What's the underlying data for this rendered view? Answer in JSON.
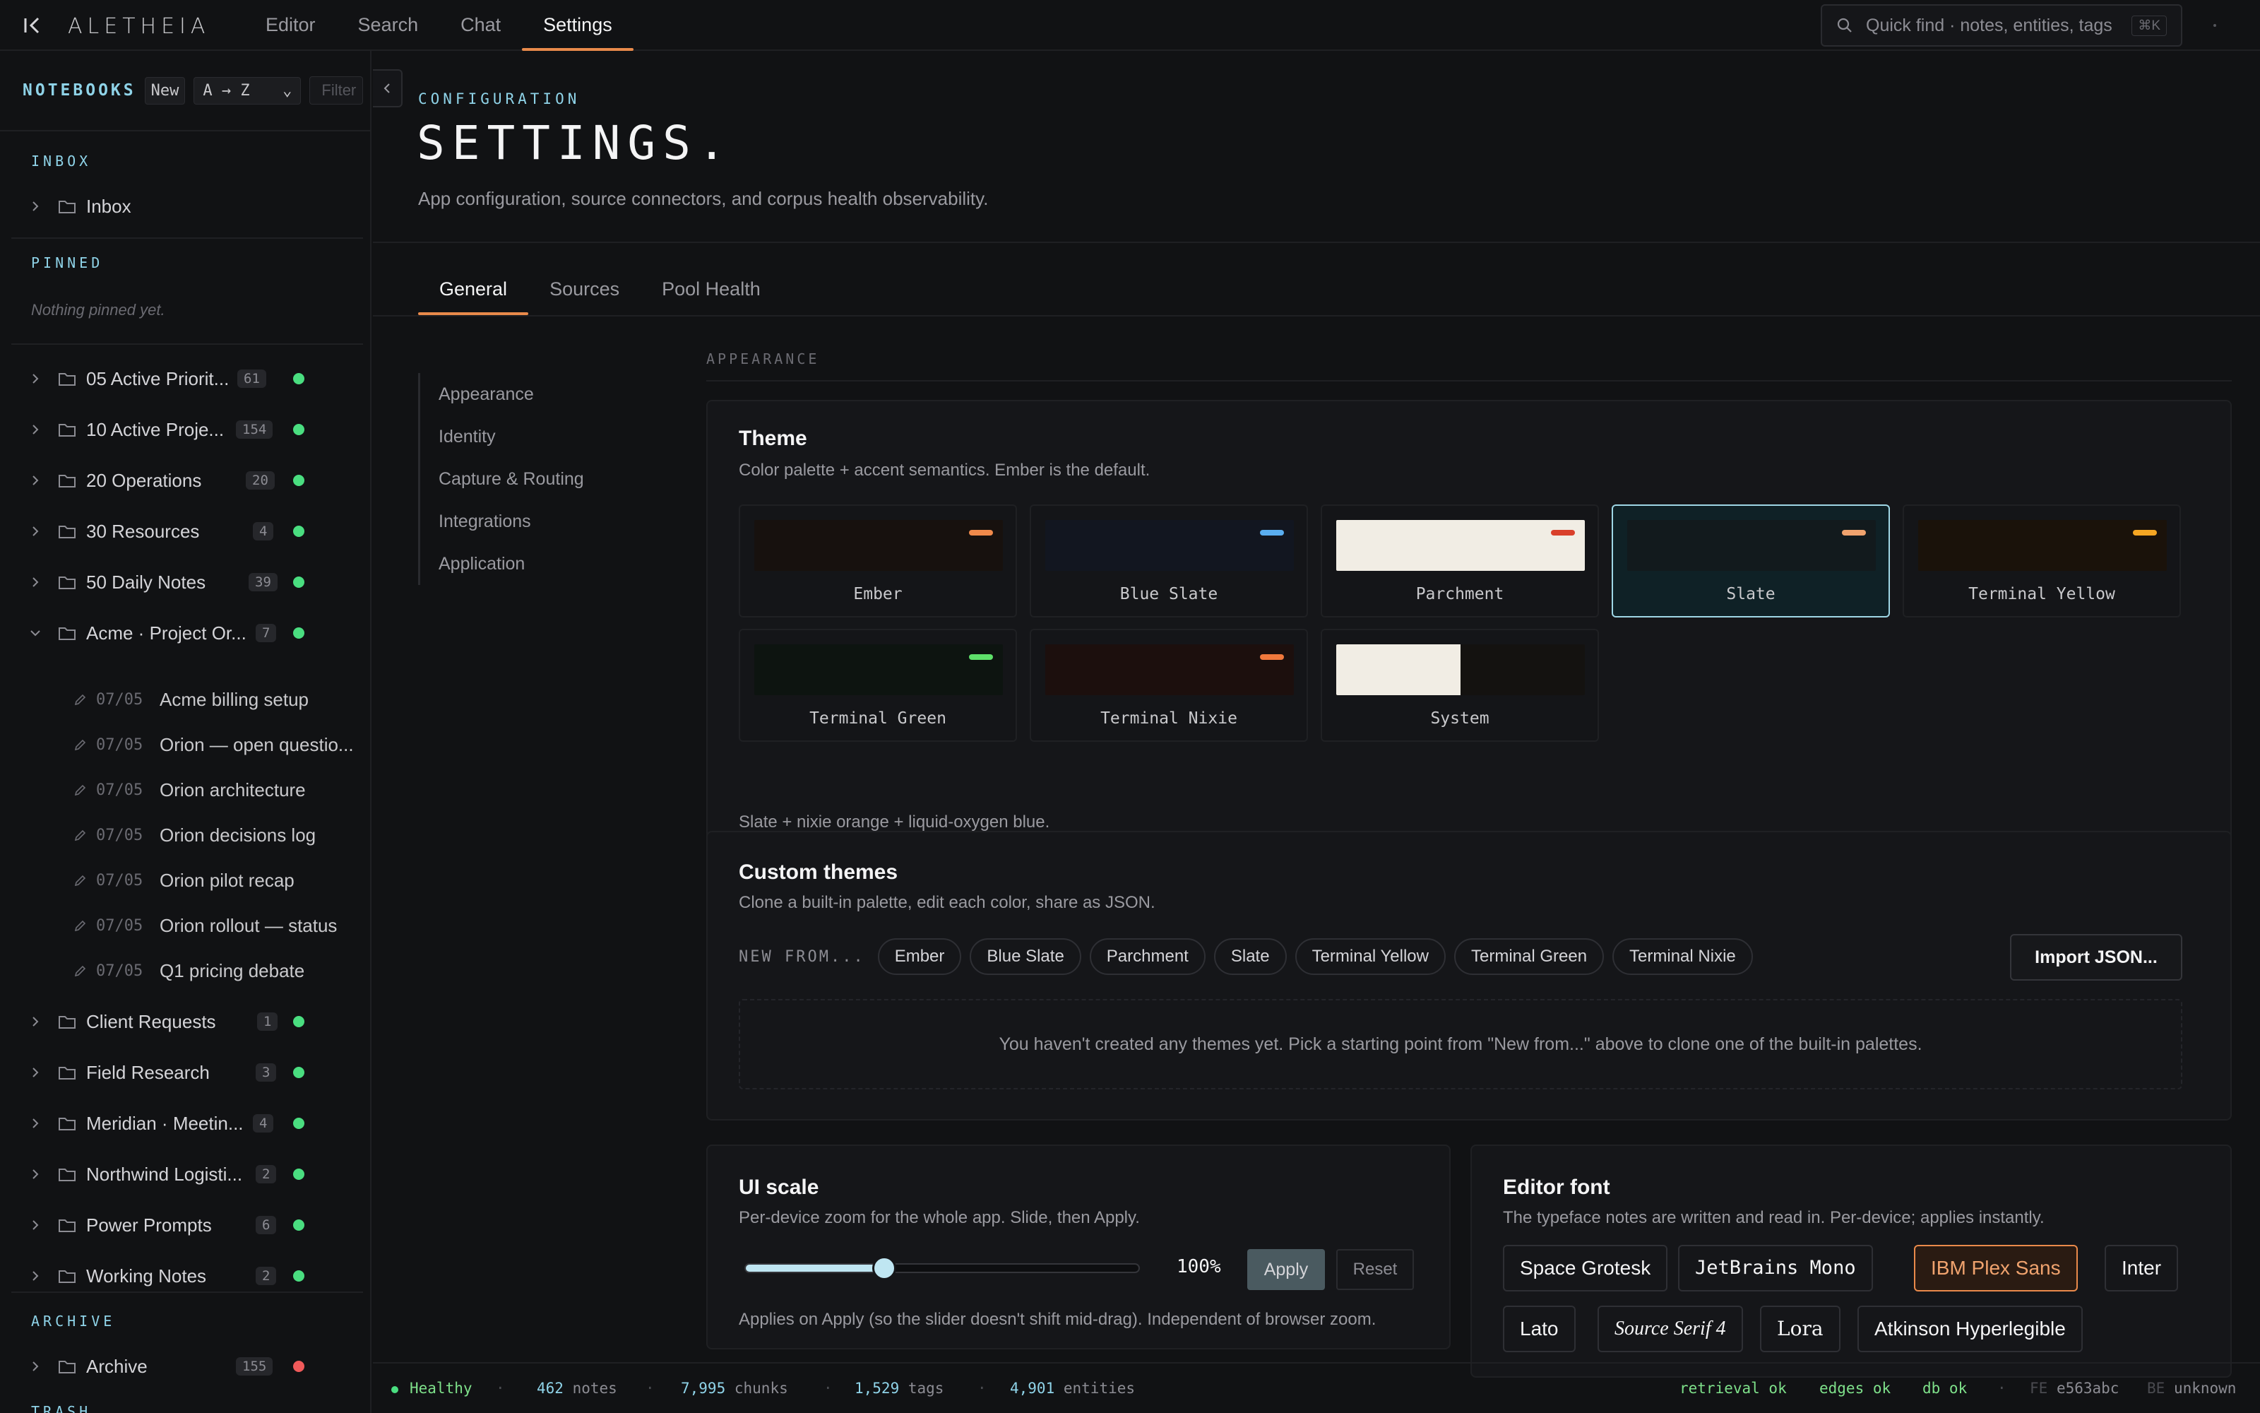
{
  "app": {
    "brand": "ALETHEIA"
  },
  "nav": [
    {
      "label": "Editor"
    },
    {
      "label": "Search"
    },
    {
      "label": "Chat"
    },
    {
      "label": "Settings"
    }
  ],
  "quick_find": {
    "placeholder": "Quick find · notes, entities, tags",
    "shortcut": "⌘K"
  },
  "sidebar": {
    "title": "NOTEBOOKS",
    "new_label": "New",
    "sort_value": "A → Z",
    "filter_placeholder": "Filter",
    "inbox_label": "INBOX",
    "inbox_item": "Inbox",
    "pinned_label": "PINNED",
    "pinned_empty": "Nothing pinned yet.",
    "folders": [
      {
        "name": "05 Active Priorit...",
        "count": "61"
      },
      {
        "name": "10 Active Proje...",
        "count": "154"
      },
      {
        "name": "20 Operations",
        "count": "20"
      },
      {
        "name": "30 Resources",
        "count": "4"
      },
      {
        "name": "50 Daily Notes",
        "count": "39"
      },
      {
        "name": "Acme · Project Or...",
        "count": "7"
      }
    ],
    "notes": [
      {
        "date": "07/05",
        "title": "Acme billing setup"
      },
      {
        "date": "07/05",
        "title": "Orion — open questio..."
      },
      {
        "date": "07/05",
        "title": "Orion architecture"
      },
      {
        "date": "07/05",
        "title": "Orion decisions log"
      },
      {
        "date": "07/05",
        "title": "Orion pilot recap"
      },
      {
        "date": "07/05",
        "title": "Orion rollout — status"
      },
      {
        "date": "07/05",
        "title": "Q1 pricing debate"
      }
    ],
    "folders2": [
      {
        "name": "Client Requests",
        "count": "1"
      },
      {
        "name": "Field Research",
        "count": "3"
      },
      {
        "name": "Meridian · Meetin...",
        "count": "4"
      },
      {
        "name": "Northwind Logisti...",
        "count": "2"
      },
      {
        "name": "Power Prompts",
        "count": "6"
      },
      {
        "name": "Working Notes",
        "count": "2"
      }
    ],
    "archive_label": "ARCHIVE",
    "archive_item": {
      "name": "Archive",
      "count": "155"
    },
    "trash_label": "TRASH"
  },
  "main": {
    "kicker": "CONFIGURATION",
    "title": "SETTINGS.",
    "subtitle": "App configuration, source connectors, and corpus health observability.",
    "tabs": [
      {
        "label": "General"
      },
      {
        "label": "Sources"
      },
      {
        "label": "Pool Health"
      }
    ],
    "subnav": [
      {
        "label": "Appearance"
      },
      {
        "label": "Identity"
      },
      {
        "label": "Capture & Routing"
      },
      {
        "label": "Integrations"
      },
      {
        "label": "Application"
      }
    ],
    "section_label": "APPEARANCE",
    "theme": {
      "title": "Theme",
      "desc": "Color palette + accent semantics. Ember is the default.",
      "themes": [
        {
          "name": "Ember",
          "bg": "#17110e",
          "accent": "#f08a4b"
        },
        {
          "name": "Blue Slate",
          "bg": "#121620",
          "accent": "#5aaef0"
        },
        {
          "name": "Parchment",
          "bg": "#f1ede4",
          "accent": "#d9402b"
        },
        {
          "name": "Slate",
          "bg": "#121a1d",
          "accent": "#f0a36e"
        },
        {
          "name": "Terminal Yellow",
          "bg": "#1a120a",
          "accent": "#f5a623"
        },
        {
          "name": "Terminal Green",
          "bg": "#0d1410",
          "accent": "#5ee06a"
        },
        {
          "name": "Terminal Nixie",
          "bg": "#1c0f0d",
          "accent": "#f0783c"
        },
        {
          "name": "System",
          "bg": "#f1ede4",
          "accent": ""
        }
      ],
      "selected_desc": "Slate + nixie orange + liquid-oxygen blue."
    },
    "custom_themes": {
      "title": "Custom themes",
      "desc": "Clone a built-in palette, edit each color, share as JSON.",
      "new_from_label": "NEW FROM...",
      "pills": [
        "Ember",
        "Blue Slate",
        "Parchment",
        "Slate",
        "Terminal Yellow",
        "Terminal Green",
        "Terminal Nixie"
      ],
      "import_label": "Import JSON...",
      "empty": "You haven't created any themes yet. Pick a starting point from \"New from...\" above to clone one of the built-in palettes."
    },
    "ui_scale": {
      "title": "UI scale",
      "desc": "Per-device zoom for the whole app. Slide, then Apply.",
      "value": "100%",
      "slider_fraction": 0.35,
      "apply_label": "Apply",
      "reset_label": "Reset",
      "note": "Applies on Apply (so the slider doesn't shift mid-drag). Independent of browser zoom."
    },
    "editor_font": {
      "title": "Editor font",
      "desc": "The typeface notes are written and read in. Per-device; applies instantly.",
      "fonts": [
        "Space Grotesk",
        "JetBrains Mono",
        "IBM Plex Sans",
        "Inter",
        "Lato",
        "Source Serif 4",
        "Lora",
        "Atkinson Hyperlegible"
      ],
      "selected": "IBM Plex Sans"
    }
  },
  "footer": {
    "health": "Healthy",
    "notes_count": "462",
    "notes_label": "notes",
    "chunks_count": "7,995",
    "chunks_label": "chunks",
    "tags_count": "1,529",
    "tags_label": "tags",
    "entities_count": "4,901",
    "entities_label": "entities",
    "retrieval": "retrieval ok",
    "edges": "edges ok",
    "db": "db ok",
    "fe_label": "FE",
    "fe_value": "e563abc",
    "be_label": "BE",
    "be_value": "unknown"
  },
  "colors": {
    "accent": "#e98a4b",
    "cyan": "#8fd3e8",
    "ok": "#4ade80",
    "error": "#f05a5a"
  }
}
